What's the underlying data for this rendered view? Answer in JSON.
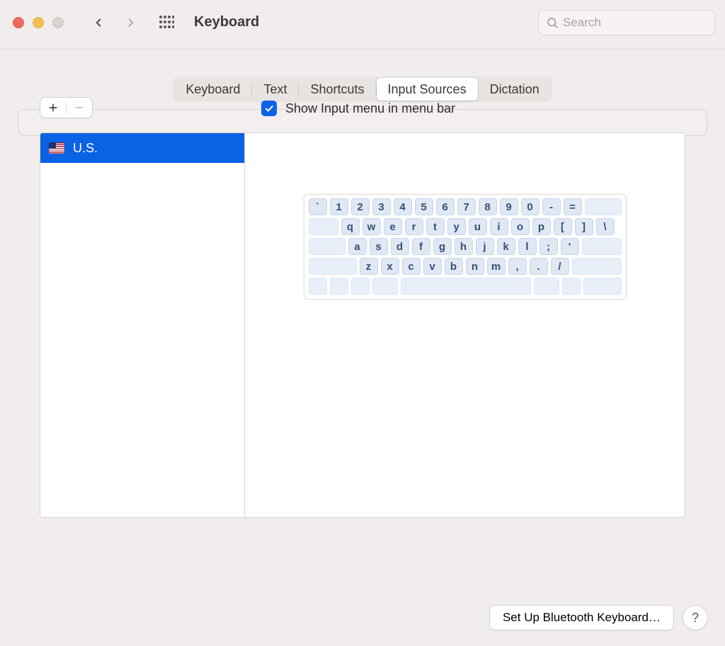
{
  "window": {
    "title": "Keyboard"
  },
  "search": {
    "placeholder": "Search"
  },
  "tabs": {
    "items": [
      "Keyboard",
      "Text",
      "Shortcuts",
      "Input Sources",
      "Dictation"
    ],
    "selected_index": 3
  },
  "sources": {
    "items": [
      {
        "label": "U.S.",
        "flag": "us",
        "selected": true
      }
    ]
  },
  "checkbox": {
    "show_input_menu_label": "Show Input menu in menu bar",
    "show_input_menu_checked": true
  },
  "buttons": {
    "bluetooth_label": "Set Up Bluetooth Keyboard…"
  },
  "keyboard_layout": {
    "row1": [
      "`",
      "1",
      "2",
      "3",
      "4",
      "5",
      "6",
      "7",
      "8",
      "9",
      "0",
      "-",
      "="
    ],
    "row2": [
      "q",
      "w",
      "e",
      "r",
      "t",
      "y",
      "u",
      "i",
      "o",
      "p",
      "[",
      "]",
      "\\"
    ],
    "row3": [
      "a",
      "s",
      "d",
      "f",
      "g",
      "h",
      "j",
      "k",
      "l",
      ";",
      "'"
    ],
    "row4": [
      "z",
      "x",
      "c",
      "v",
      "b",
      "n",
      "m",
      ",",
      ".",
      "/"
    ]
  }
}
